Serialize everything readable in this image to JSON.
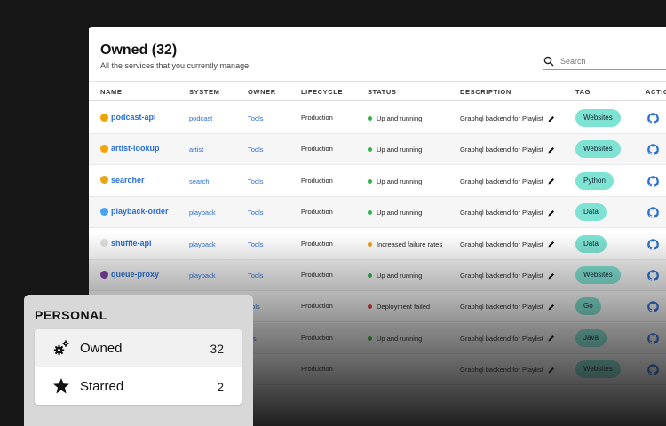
{
  "header": {
    "title": "Owned (32)",
    "subtitle": "All the services that you currently manage"
  },
  "search": {
    "placeholder": "Search"
  },
  "columns": [
    "NAME",
    "SYSTEM",
    "OWNER",
    "LIFECYCLE",
    "STATUS",
    "DESCRIPTION",
    "TAG",
    "ACTIO"
  ],
  "rows": [
    {
      "name": "podcast-api",
      "system": "podcast",
      "owner": "Tools",
      "lifecycle": "Production",
      "status": "Up and running",
      "status_color": "#2fb344",
      "description": "Graphql backend for Playlist",
      "tag": "Websites",
      "logo_color": "#f0a400"
    },
    {
      "name": "artist-lookup",
      "system": "artist",
      "owner": "Tools",
      "lifecycle": "Production",
      "status": "Up and running",
      "status_color": "#2fb344",
      "description": "Graphql backend for Playlist",
      "tag": "Websites",
      "logo_color": "#f4a300"
    },
    {
      "name": "searcher",
      "system": "search",
      "owner": "Tools",
      "lifecycle": "Production",
      "status": "Up and running",
      "status_color": "#2fb344",
      "description": "Graphql backend for Playlist",
      "tag": "Python",
      "logo_color": "#e8a617"
    },
    {
      "name": "playback-order",
      "system": "playback",
      "owner": "Tools",
      "lifecycle": "Production",
      "status": "Up and running",
      "status_color": "#2fb344",
      "description": "Graphql backend for Playlist",
      "tag": "Data",
      "logo_color": "#42a5f5"
    },
    {
      "name": "shuffle-api",
      "system": "playback",
      "owner": "Tools",
      "lifecycle": "Production",
      "status": "Increased failure rates",
      "status_color": "#f59e0b",
      "description": "Graphql backend for Playlist",
      "tag": "Data",
      "logo_color": "#e0e0e0"
    },
    {
      "name": "queue-proxy",
      "system": "playback",
      "owner": "Tools",
      "lifecycle": "Production",
      "status": "Up and running",
      "status_color": "#2fb344",
      "description": "Graphql backend for Playlist",
      "tag": "Websites",
      "logo_color": "#7b3fa0"
    },
    {
      "name": "",
      "system": "",
      "owner": "ools",
      "lifecycle": "Production",
      "status": "Deployment failed",
      "status_color": "#e53935",
      "description": "Graphql backend for Playlist",
      "tag": "Go",
      "logo_color": ""
    },
    {
      "name": "",
      "system": "",
      "owner": "ols",
      "lifecycle": "Production",
      "status": "Up and running",
      "status_color": "#2fb344",
      "description": "Graphql backend for Playlist",
      "tag": "Java",
      "logo_color": ""
    },
    {
      "name": "",
      "system": "",
      "owner": "",
      "lifecycle": "Production",
      "status": "",
      "status_color": "#2fb344",
      "description": "Graphql backend for Playlist",
      "tag": "Websites",
      "logo_color": ""
    }
  ],
  "personal": {
    "title": "PERSONAL",
    "items": [
      {
        "label": "Owned",
        "count": "32",
        "icon": "gears-icon"
      },
      {
        "label": "Starred",
        "count": "2",
        "icon": "star-icon"
      }
    ]
  },
  "colors": {
    "link": "#2b6fd6",
    "tag": "#7ee3d3",
    "background": "#171717"
  }
}
